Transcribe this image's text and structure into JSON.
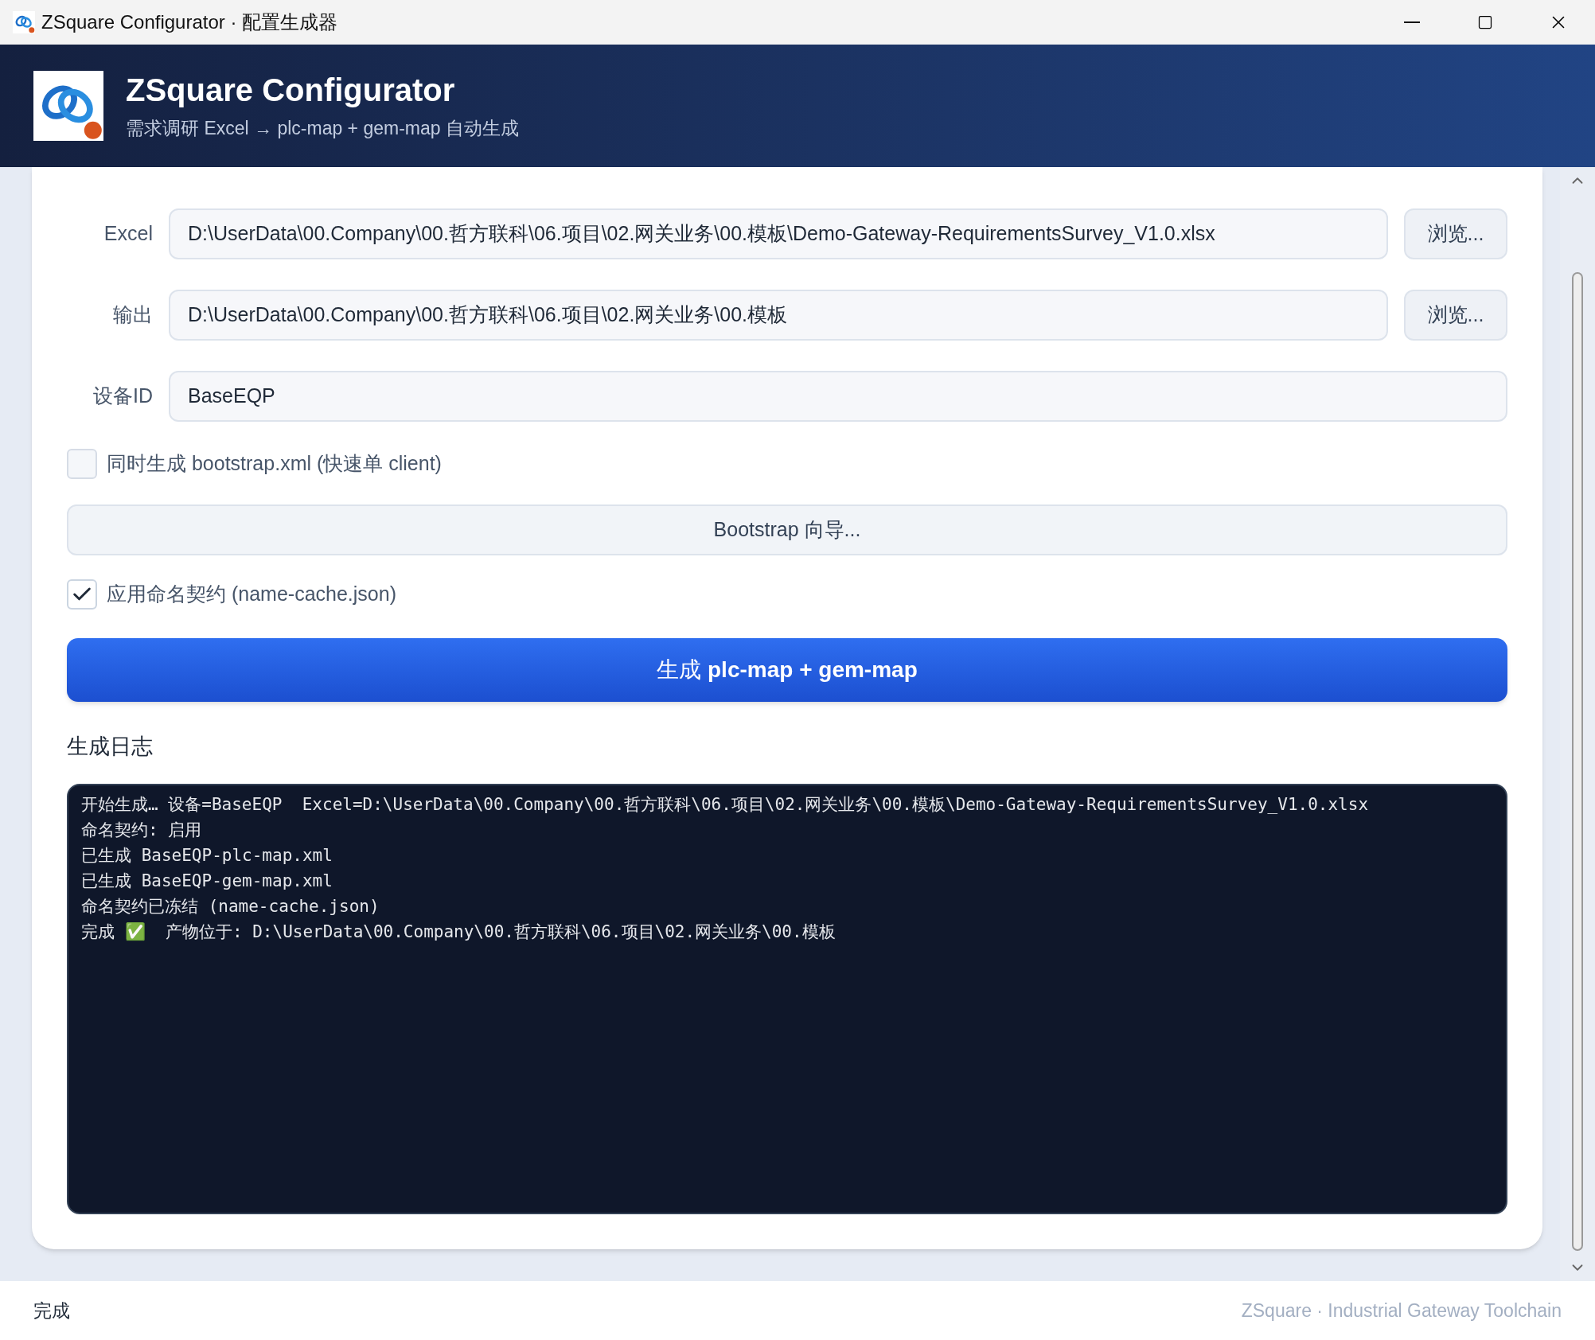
{
  "window": {
    "title": "ZSquare Configurator · 配置生成器"
  },
  "header": {
    "title": "ZSquare Configurator",
    "subtitle": "需求调研 Excel → plc-map + gem-map 自动生成"
  },
  "fields": [
    {
      "label": "Excel",
      "value": "D:\\UserData\\00.Company\\00.哲方联科\\06.项目\\02.网关业务\\00.模板\\Demo-Gateway-RequirementsSurvey_V1.0.xlsx",
      "browse": "浏览..."
    },
    {
      "label": "输出",
      "value": "D:\\UserData\\00.Company\\00.哲方联科\\06.项目\\02.网关业务\\00.模板",
      "browse": "浏览..."
    },
    {
      "label": "设备ID",
      "value": "BaseEQP"
    }
  ],
  "bootstrap_option": {
    "label": "同时生成 bootstrap.xml (快速单 client)",
    "checked": false
  },
  "bootstrap_button": "Bootstrap 向导...",
  "naming_option": {
    "label": "应用命名契约 (name-cache.json)",
    "checked": true
  },
  "generate_button": "生成 **plc-map + gem-map**",
  "log": {
    "title": "生成日志",
    "lines": [
      "开始生成… 设备=BaseEQP  Excel=D:\\UserData\\00.Company\\00.哲方联科\\06.项目\\02.网关业务\\00.模板\\Demo-Gateway-RequirementsSurvey_V1.0.xlsx",
      "命名契约: 启用",
      "已生成 BaseEQP-plc-map.xml",
      "已生成 BaseEQP-gem-map.xml",
      "命名契约已冻结 (name-cache.json)",
      "完成 ✅  产物位于: D:\\UserData\\00.Company\\00.哲方联科\\06.项目\\02.网关业务\\00.模板"
    ]
  },
  "status_bar": {
    "status": "完成",
    "credit": "ZSquare · Industrial Gateway Toolchain"
  }
}
